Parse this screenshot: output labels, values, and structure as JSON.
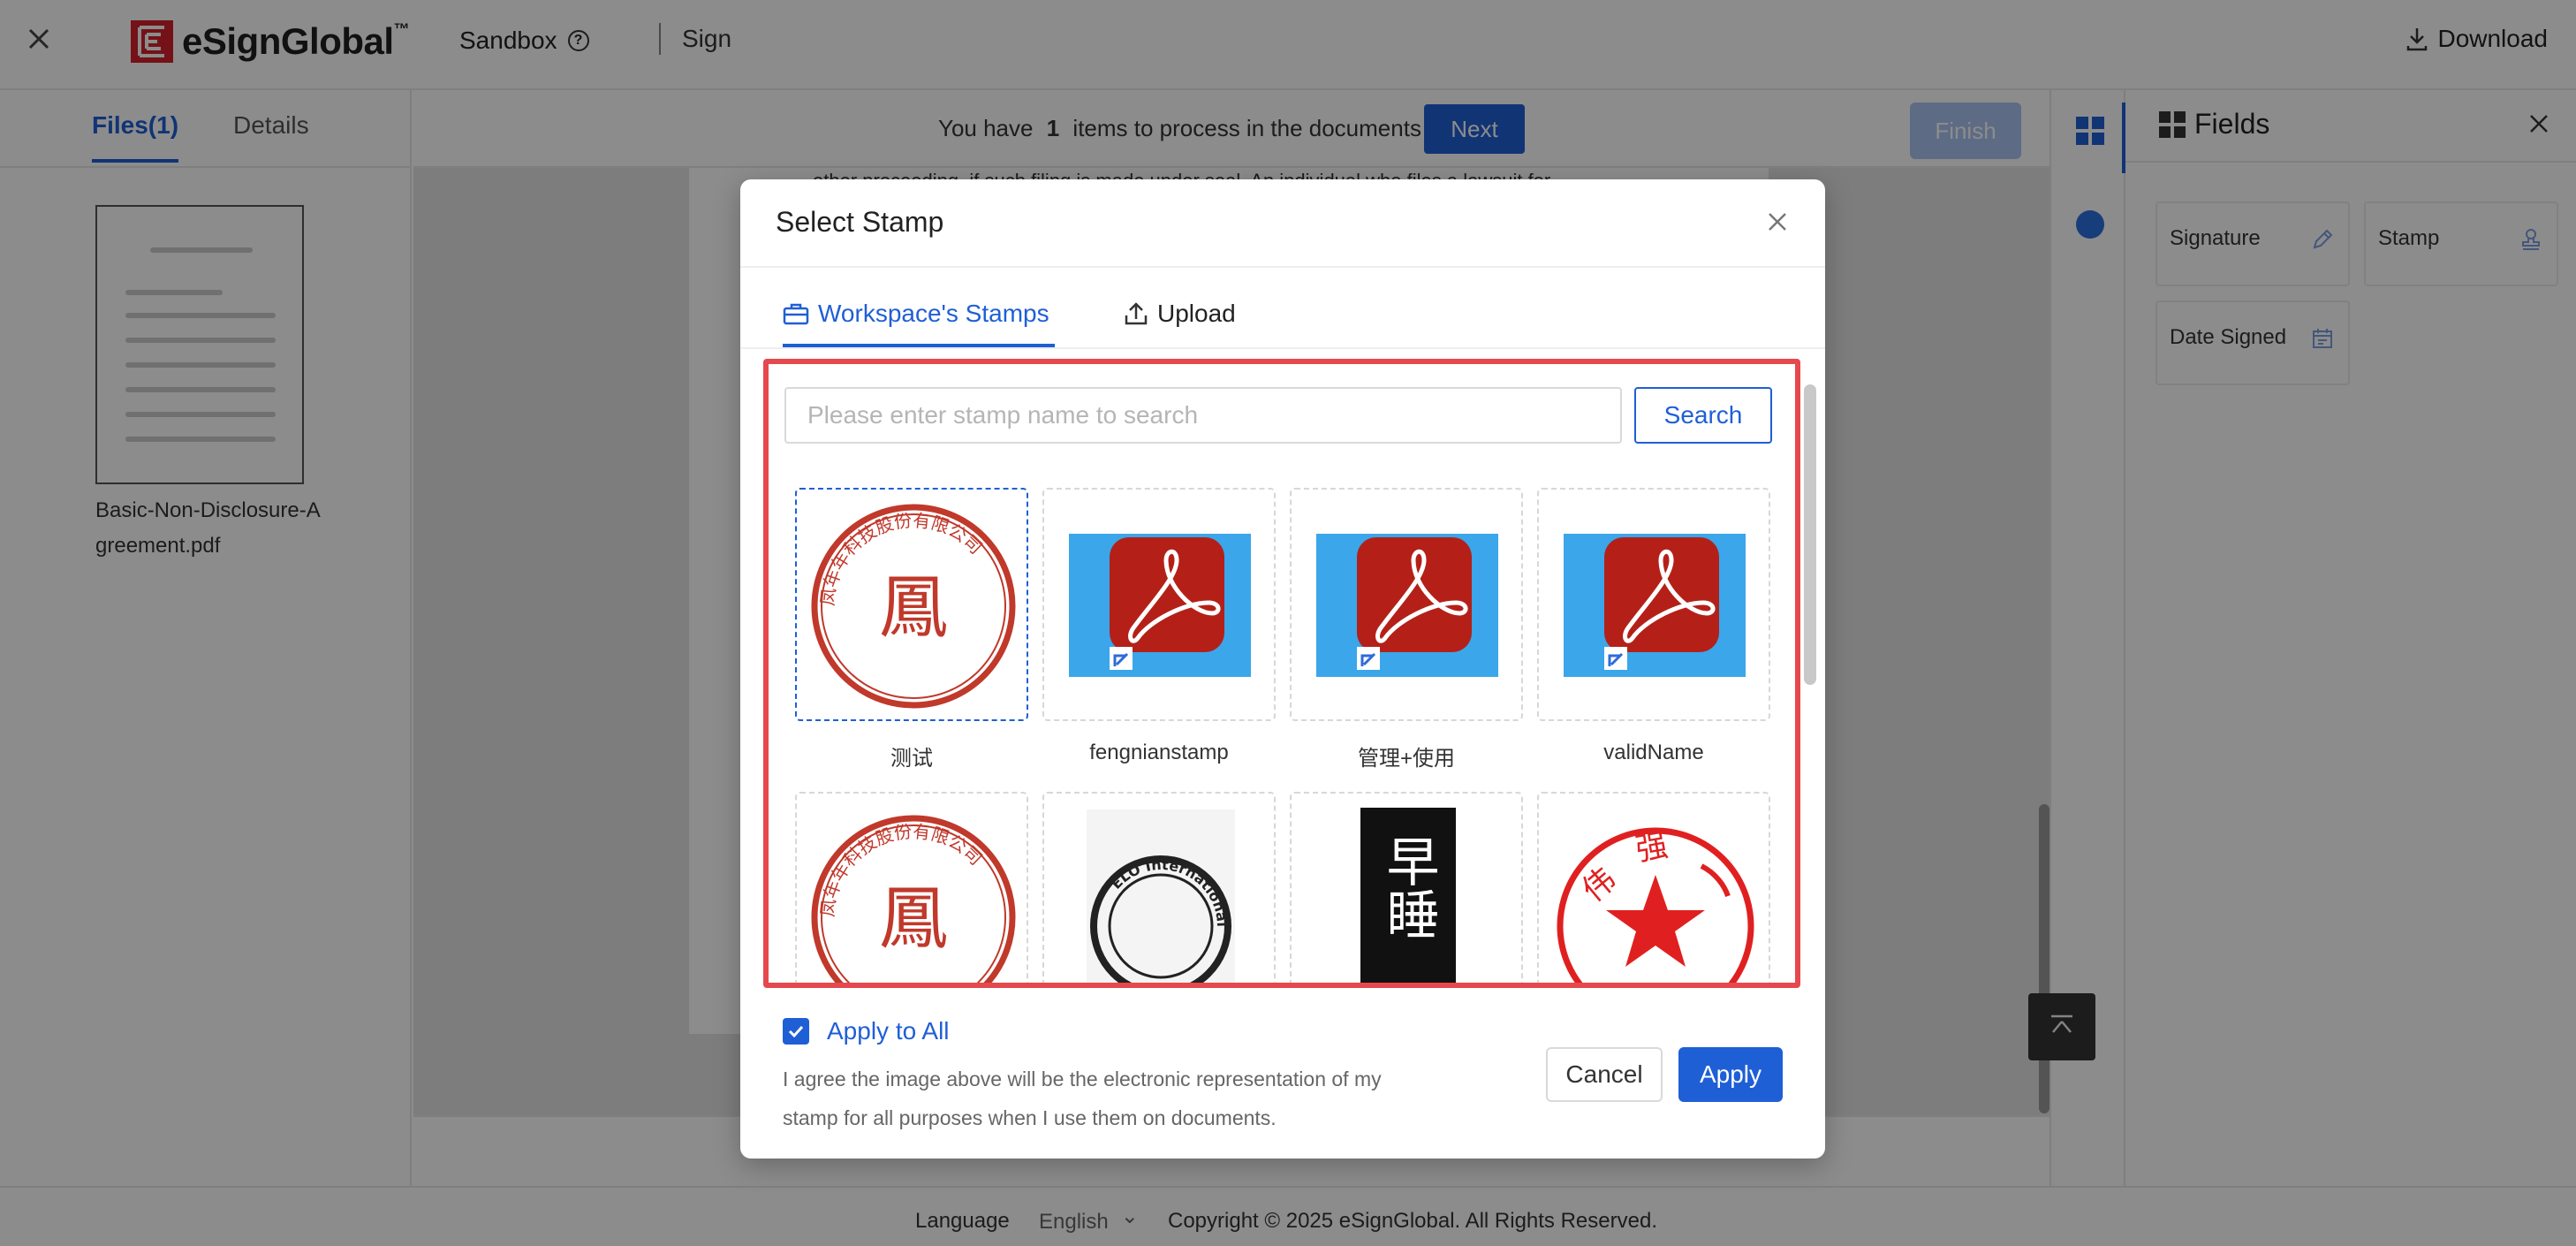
{
  "topbar": {
    "brand": "eSignGlobal",
    "brand_tm": "™",
    "environment": "Sandbox",
    "help_glyph": "?",
    "mode": "Sign",
    "download_label": "Download"
  },
  "left_panel": {
    "tab_files": "Files(1)",
    "tab_details": "Details",
    "file_name": "Basic-Non-Disclosure-Agreement.pdf"
  },
  "process": {
    "prefix": "You have",
    "count": "1",
    "suffix": "items to process in the documents",
    "next_label": "Next",
    "finish_label": "Finish",
    "doc_snippet": "other proceeding, if such filing is made under seal. An individual who files a lawsuit for"
  },
  "fields_panel": {
    "title": "Fields",
    "items": [
      {
        "label": "Signature",
        "icon": "pen-icon"
      },
      {
        "label": "Stamp",
        "icon": "stamp-icon"
      },
      {
        "label": "Date Signed",
        "icon": "calendar-icon"
      }
    ]
  },
  "modal": {
    "title": "Select Stamp",
    "tabs": [
      {
        "label": "Workspace's Stamps",
        "icon": "briefcase-icon",
        "active": true
      },
      {
        "label": "Upload",
        "icon": "upload-icon",
        "active": false
      }
    ],
    "search": {
      "placeholder": "Please enter stamp name to search",
      "value": "",
      "button_label": "Search"
    },
    "stamps": [
      {
        "name": "测试",
        "image": "red-round-seal-icon",
        "selected": true
      },
      {
        "name": "fengnianstamp",
        "image": "pdf-file-icon",
        "selected": false
      },
      {
        "name": "管理+使用",
        "image": "pdf-file-icon",
        "selected": false
      },
      {
        "name": "validName",
        "image": "pdf-file-icon",
        "selected": false
      },
      {
        "name": "",
        "image": "red-round-seal-icon",
        "selected": false
      },
      {
        "name": "",
        "image": "black-round-seal-icon",
        "selected": false
      },
      {
        "name": "",
        "image": "black-vertical-seal-icon",
        "selected": false
      },
      {
        "name": "",
        "image": "red-star-seal-icon",
        "selected": false
      }
    ],
    "seal_text": {
      "ring": "凤年年科技股份有限公司",
      "center": "鳳",
      "vertical": "早睡",
      "elo": "ELO International",
      "star_seal": [
        "伟",
        "强"
      ]
    },
    "apply_all_label": "Apply to All",
    "apply_all_checked": true,
    "agree_text": "I agree the image above will be the electronic representation of my stamp for all purposes when I use them on documents.",
    "cancel_label": "Cancel",
    "apply_label": "Apply"
  },
  "footer": {
    "language_label": "Language",
    "language_value": "English",
    "copyright": "Copyright © 2025 eSignGlobal. All Rights Reserved."
  },
  "colors": {
    "brand_red": "#d3222a",
    "primary_blue": "#1f5fd6",
    "highlight_red": "#e5484d",
    "disabled_blue": "#a9c4f3"
  }
}
